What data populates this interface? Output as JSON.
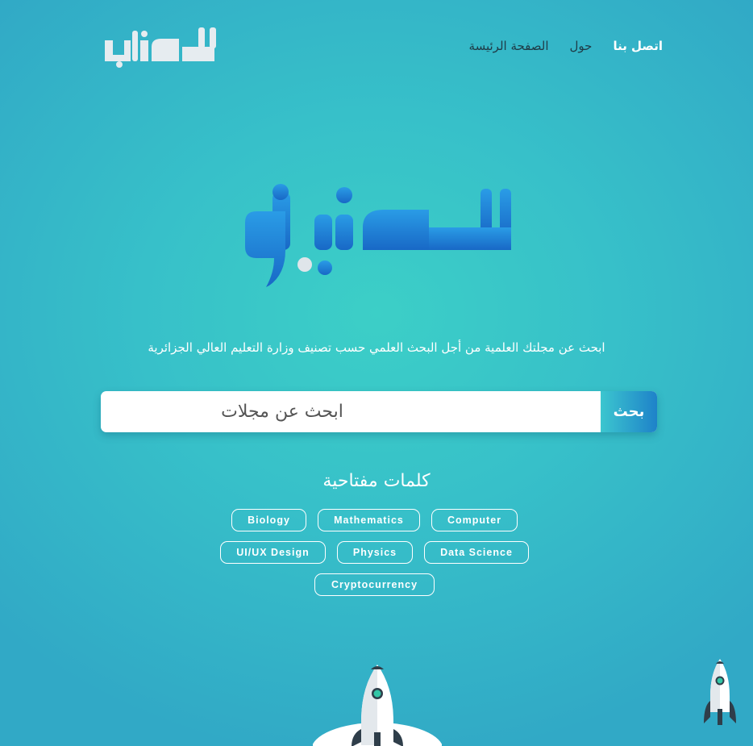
{
  "header": {
    "logo_text": "تصنيفو",
    "nav": [
      {
        "label": "اتصل بنا"
      },
      {
        "label": "حول"
      },
      {
        "label": "الصفحة الرئيسة"
      }
    ]
  },
  "hero": {
    "logo_text": "تصنيفو",
    "subtitle": "ابحث عن مجلتك العلمية من أجل البحث العلمي حسب تصنيف وزارة التعليم العالي الجزائرية"
  },
  "search": {
    "placeholder": "ابحث عن مجلات",
    "button_label": "بحث"
  },
  "keywords": {
    "title": "كلمات مفتاحية",
    "tags": [
      "Biology",
      "Mathematics",
      "Computer",
      "UI/UX Design",
      "Physics",
      "Data Science",
      "Cryptocurrency"
    ]
  },
  "colors": {
    "background": "#37c0c9",
    "accent_blue": "#1e82c9",
    "logo_light": "#e8eef2"
  }
}
